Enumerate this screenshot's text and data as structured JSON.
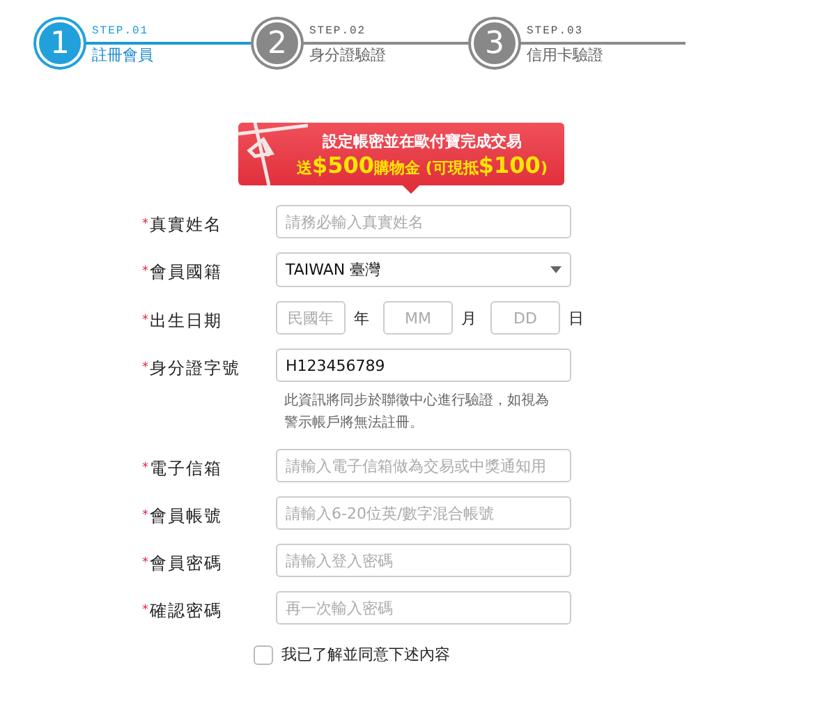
{
  "steps": [
    {
      "number": "1",
      "step": "STEP.01",
      "label": "註冊會員",
      "selected": true
    },
    {
      "number": "2",
      "step": "STEP.02",
      "label": "身分證驗證",
      "selected": false
    },
    {
      "number": "3",
      "step": "STEP.03",
      "label": "信用卡驗證",
      "selected": false
    }
  ],
  "banner": {
    "line1": "設定帳密並在歐付寶完成交易",
    "line2": "送**$500**購物金 (可現抵**$100**)"
  },
  "fields": [
    {
      "kind": "text",
      "required": true,
      "label": "真實姓名",
      "placeholder": "請務必輸入真實姓名"
    },
    {
      "kind": "select",
      "required": true,
      "label": "會員國籍",
      "value": "TAIWAN 臺灣"
    },
    {
      "kind": "date",
      "required": true,
      "label": "出生日期",
      "parts": [
        {
          "placeholder": "民國年",
          "unit": "年"
        },
        {
          "placeholder": "MM",
          "unit": "月"
        },
        {
          "placeholder": "DD",
          "unit": "日"
        }
      ]
    },
    {
      "kind": "text",
      "required": true,
      "label": "身分證字號",
      "value": "H123456789",
      "hint": "此資訊將同步於聯徵中心進行驗證，如視為警示帳戶將無法註冊。"
    },
    {
      "kind": "text",
      "required": true,
      "label": "電子信箱",
      "placeholder": "請輸入電子信箱做為交易或中獎通知用"
    },
    {
      "kind": "text",
      "required": true,
      "label": "會員帳號",
      "placeholder": "請輸入6-20位英/數字混合帳號"
    },
    {
      "kind": "text",
      "required": true,
      "label": "會員密碼",
      "placeholder": "請輸入登入密碼"
    },
    {
      "kind": "text",
      "required": true,
      "label": "確認密碼",
      "placeholder": "再一次輸入密碼"
    }
  ],
  "required_mark": "*",
  "agreement": {
    "label": "我已了解並同意下述內容",
    "checked": false
  }
}
